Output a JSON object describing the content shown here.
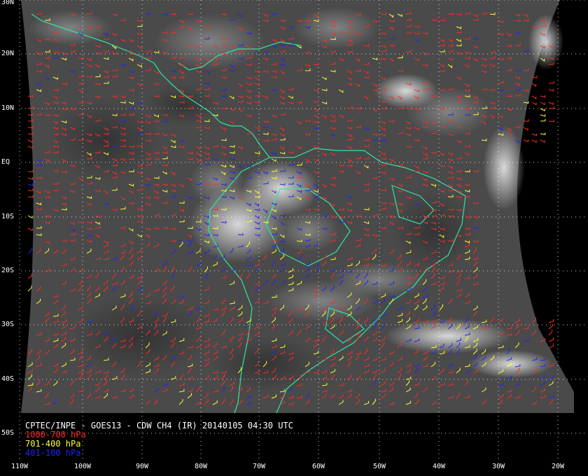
{
  "title": "CPTEC/INPE - GOES13 - CDW CH4 (IR) 20140105 04:30 UTC",
  "legend": [
    {
      "label": "1000-700 hPa",
      "color": "#ff2a2a"
    },
    {
      "label": "701-400 hPa",
      "color": "#ffff33"
    },
    {
      "label": "401-100 hPa",
      "color": "#2222ff"
    }
  ],
  "colors": {
    "background": "#000000",
    "disc": "#4a4a4a",
    "coastline": "#2ee6a0",
    "grid": "#ffffff"
  },
  "lat_labels": [
    "30N",
    "20N",
    "10N",
    "EQ",
    "10S",
    "20S",
    "30S",
    "40S",
    "50S"
  ],
  "lon_labels": [
    "110W",
    "100W",
    "90W",
    "80W",
    "70W",
    "60W",
    "50W",
    "40W",
    "30W",
    "20W"
  ]
}
